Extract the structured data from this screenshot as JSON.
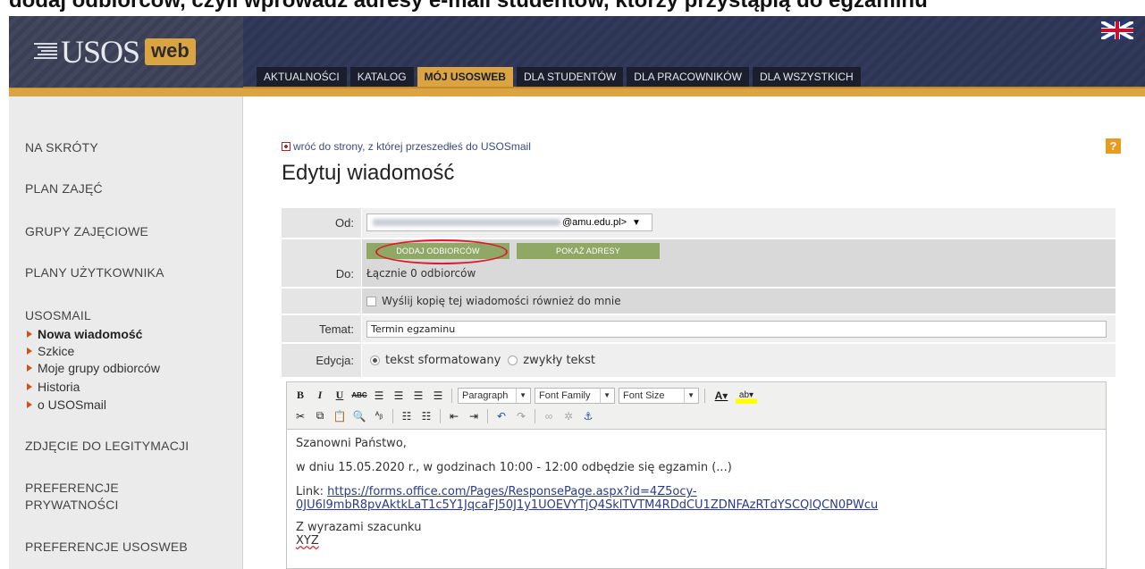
{
  "caption": "dodaj odbiorców, czyli wprowadź adresy e-mail studentów, którzy przystąpią do egzaminu",
  "header": {
    "logo_text": "USOS",
    "logo_badge": "web",
    "tabs": [
      {
        "label": "AKTUALNOŚCI"
      },
      {
        "label": "KATALOG"
      },
      {
        "label": "MÓJ USOSWEB"
      },
      {
        "label": "DLA STUDENTÓW"
      },
      {
        "label": "DLA PRACOWNIKÓW"
      },
      {
        "label": "DLA WSZYSTKICH"
      }
    ],
    "active_tab": "MÓJ USOSWEB"
  },
  "sidebar": {
    "items": [
      {
        "label": "NA SKRÓTY"
      },
      {
        "label": "PLAN ZAJĘĆ"
      },
      {
        "label": "GRUPY ZAJĘCIOWE"
      },
      {
        "label": "PLANY UŻYTKOWNIKA"
      },
      {
        "label": "USOSMAIL"
      },
      {
        "label": "ZDJĘCIE DO LEGITYMACJI"
      },
      {
        "label": "PREFERENCJE"
      },
      {
        "label": "PRYWATNOŚCI"
      },
      {
        "label": "PREFERENCJE USOSWEB"
      }
    ],
    "usosmail_sub": [
      {
        "label": "Nowa wiadomość"
      },
      {
        "label": "Szkice"
      },
      {
        "label": "Moje grupy odbiorców"
      },
      {
        "label": "Historia"
      },
      {
        "label": "o USOSmail"
      }
    ]
  },
  "main": {
    "back_link": "wróć do strony, z której przeszedłeś do USOSmail",
    "help": "?",
    "title": "Edytuj wiadomość",
    "form": {
      "from_label": "Od:",
      "from_value": "@amu.edu.pl>",
      "to_label": "Do:",
      "add_recipients": "DODAJ ODBIORCÓW",
      "show_addresses": "POKAŻ ADRESY",
      "recipients_count": "Łącznie 0 odbiorców",
      "send_copy": "Wyślij kopię tej wiadomości również do mnie",
      "subject_label": "Temat:",
      "subject_value": "Termin egzaminu",
      "edit_label": "Edycja:",
      "edit_rich": "tekst sformatowany",
      "edit_plain": "zwykły tekst",
      "edit_selected": "tekst sformatowany"
    },
    "toolbar": {
      "paragraph": "Paragraph",
      "font_family": "Font Family",
      "font_size": "Font Size"
    },
    "editor": {
      "greeting": "Szanowni Państwo,",
      "body": "w dniu 15.05.2020 r., w godzinach 10:00 - 12:00 odbędzie się egzamin (...)",
      "link_label": "Link:",
      "link_line1": "https://forms.office.com/Pages/ResponsePage.aspx?id=4Z5ocy-",
      "link_line2": "0JU6l9mbR8pvAktkLaT1c5Y1JqcaFJ50J1y1UOEVYTjQ4SklTVTM4RDdCU1ZDNFAzRTdYSCQlQCN0PWcu",
      "closing": "Z wyrazami szacunku",
      "signature": "XYZ"
    },
    "colors": {
      "header_dark": "#2d3454",
      "accent_gold": "#d9a441",
      "button_green": "#8fa866",
      "highlight_red": "#e0192a"
    }
  }
}
